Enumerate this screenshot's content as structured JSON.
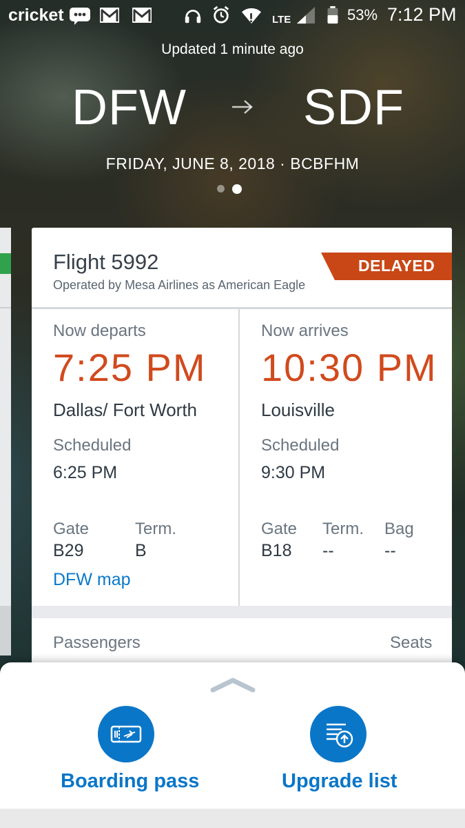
{
  "status_bar": {
    "carrier": "cricket",
    "network": "LTE",
    "battery": "53%",
    "time": "7:12 PM"
  },
  "header": {
    "updated": "Updated 1 minute ago",
    "origin": "DFW",
    "destination": "SDF",
    "date_code": "FRIDAY, JUNE 8, 2018 · BCBFHM",
    "page_count": 2,
    "active_page": 2
  },
  "flight": {
    "title": "Flight 5992",
    "operated_by": "Operated by Mesa Airlines as American Eagle",
    "status": "DELAYED",
    "status_color": "#c94717"
  },
  "departure": {
    "heading": "Now departs",
    "time": "7:25 PM",
    "city": "Dallas/ Fort Worth",
    "scheduled_label": "Scheduled",
    "scheduled_time": "6:25 PM",
    "gate_label": "Gate",
    "gate": "B29",
    "term_label": "Term.",
    "term": "B",
    "map_link": "DFW map"
  },
  "arrival": {
    "heading": "Now arrives",
    "time": "10:30 PM",
    "city": "Louisville",
    "scheduled_label": "Scheduled",
    "scheduled_time": "9:30 PM",
    "gate_label": "Gate",
    "gate": "B18",
    "term_label": "Term.",
    "term": "--",
    "bag_label": "Bag",
    "bag": "--"
  },
  "passengers": {
    "label": "Passengers",
    "seats_label": "Seats"
  },
  "actions": {
    "boarding_pass": "Boarding pass",
    "upgrade_list": "Upgrade list",
    "accent_color": "#0a76c8"
  }
}
